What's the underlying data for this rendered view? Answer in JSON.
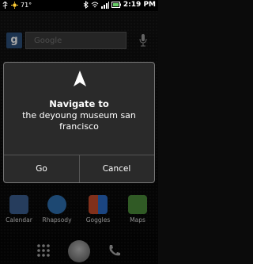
{
  "status_bar": {
    "temperature": "71°",
    "time": "2:19 PM",
    "icons": [
      "usb-icon",
      "sun-icon",
      "bluetooth-icon",
      "wifi-icon",
      "signal-icon",
      "battery-icon"
    ]
  },
  "search_widget": {
    "logo_letter": "g",
    "placeholder": "Google",
    "mic_icon": "mic-icon"
  },
  "dialog": {
    "icon": "navigation-arrow-icon",
    "title": "Navigate to",
    "message": "the deyoung museum san francisco",
    "buttons": {
      "go": "Go",
      "cancel": "Cancel"
    }
  },
  "apps": [
    {
      "label": "Calendar",
      "icon": "calendar-icon",
      "color": "#3b5f8f"
    },
    {
      "label": "Rhapsody",
      "icon": "rhapsody-icon",
      "color": "#2d6fb0"
    },
    {
      "label": "Goggles",
      "icon": "goggles-icon",
      "color": "#c64a2a"
    },
    {
      "label": "Maps",
      "icon": "maps-icon",
      "color": "#4a8a3a"
    }
  ],
  "dock": {
    "icons": [
      "app-drawer-icon",
      "home-icon",
      "phone-icon"
    ]
  },
  "colors": {
    "dialog_bg": "#2a2a2a",
    "dialog_border": "#777777",
    "text": "#ffffff"
  }
}
